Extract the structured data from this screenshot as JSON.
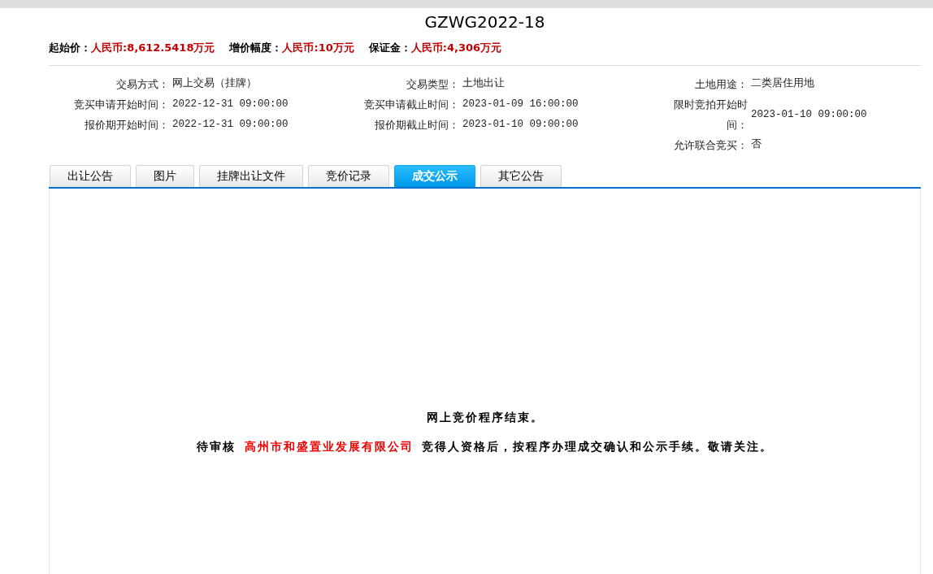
{
  "title": "GZWG2022-18",
  "prices": [
    {
      "label": "起始价：",
      "value": "人民币:8,612.5418万元"
    },
    {
      "label": "增价幅度：",
      "value": "人民币:10万元"
    },
    {
      "label": "保证金：",
      "value": "人民币:4,306万元"
    }
  ],
  "info_columns": [
    [
      {
        "label": "交易方式：",
        "value": "网上交易（挂牌）"
      },
      {
        "label": "竞买申请开始时间：",
        "value": "2022-12-31 09:00:00"
      },
      {
        "label": "报价期开始时间：",
        "value": "2022-12-31 09:00:00"
      }
    ],
    [
      {
        "label": "交易类型：",
        "value": "土地出让"
      },
      {
        "label": "竞买申请截止时间：",
        "value": "2023-01-09 16:00:00"
      },
      {
        "label": "报价期截止时间：",
        "value": "2023-01-10 09:00:00"
      }
    ],
    [
      {
        "label": "土地用途：",
        "value": "二类居住用地"
      },
      {
        "label": "限时竞拍开始时间：",
        "value": "2023-01-10 09:00:00"
      },
      {
        "label": "允许联合竞买：",
        "value": "否"
      }
    ]
  ],
  "tabs": [
    {
      "label": "出让公告",
      "selected": false
    },
    {
      "label": "图片",
      "selected": false
    },
    {
      "label": "挂牌出让文件",
      "selected": false
    },
    {
      "label": "竞价记录",
      "selected": false
    },
    {
      "label": "成交公示",
      "selected": true
    },
    {
      "label": "其它公告",
      "selected": false
    }
  ],
  "announcement": {
    "headline": "网上竞价程序结束。",
    "notice": {
      "before": "待审核",
      "company": "高州市和盛置业发展有限公司",
      "after": "竞得人资格后，按程序办理成交确认和公示手续。敬请关注。"
    }
  }
}
